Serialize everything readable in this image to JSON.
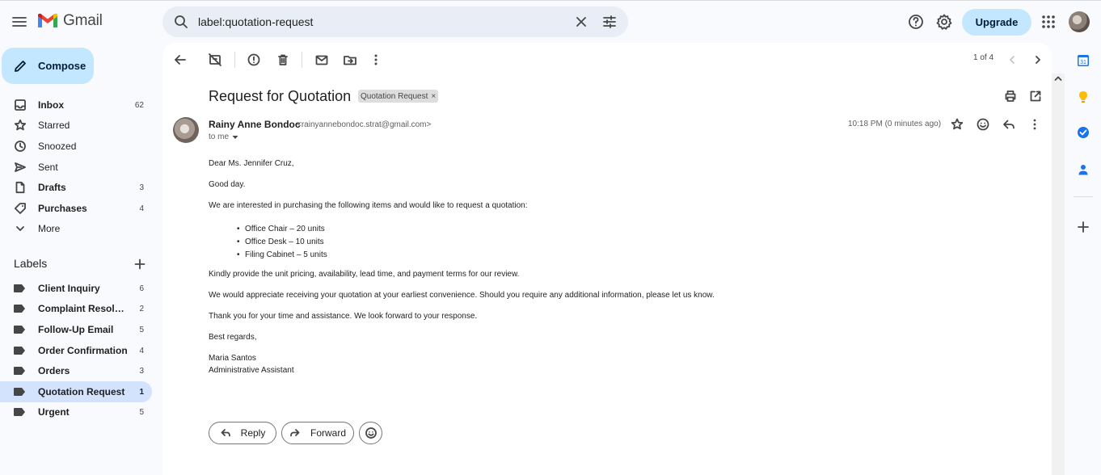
{
  "app": {
    "name": "Gmail"
  },
  "search": {
    "value": "label:quotation-request"
  },
  "header": {
    "upgrade_label": "Upgrade"
  },
  "compose": {
    "label": "Compose"
  },
  "nav": {
    "items": [
      {
        "label": "Inbox",
        "count": "62"
      },
      {
        "label": "Starred",
        "count": ""
      },
      {
        "label": "Snoozed",
        "count": ""
      },
      {
        "label": "Sent",
        "count": ""
      },
      {
        "label": "Drafts",
        "count": "3"
      },
      {
        "label": "Purchases",
        "count": "4"
      },
      {
        "label": "More",
        "count": ""
      }
    ]
  },
  "labels": {
    "heading": "Labels",
    "items": [
      {
        "label": "Client Inquiry",
        "count": "6"
      },
      {
        "label": "Complaint Resolution",
        "count": "2"
      },
      {
        "label": "Follow-Up Email",
        "count": "5"
      },
      {
        "label": "Order Confirmation",
        "count": "4"
      },
      {
        "label": "Orders",
        "count": "3"
      },
      {
        "label": "Quotation Request",
        "count": "1"
      },
      {
        "label": "Urgent",
        "count": "5"
      }
    ]
  },
  "toolbar": {
    "pager": "1 of 4"
  },
  "message": {
    "subject": "Request for Quotation",
    "label_chip": "Quotation Request",
    "sender_name": "Rainy Anne Bondoc",
    "sender_email": "<rainyannebondoc.strat@gmail.com>",
    "recipient": "to me",
    "time": "10:18 PM (0 minutes ago)",
    "body": {
      "greeting": "Dear Ms. Jennifer Cruz,",
      "line1": "Good day.",
      "intro": "We are interested in purchasing the following items and would like to request a quotation:",
      "items": [
        "Office Chair – 20 units",
        "Office Desk – 10 units",
        "Filing Cabinet – 5 units"
      ],
      "request": "Kindly provide the unit pricing, availability, lead time, and payment terms for our review.",
      "appreciate": "We would appreciate receiving your quotation at your earliest convenience. Should you require any additional information, please let us know.",
      "thanks": "Thank you for your time and assistance. We look forward to your response.",
      "closing": "Best regards,",
      "signature_name": "Maria Santos",
      "signature_title": "Administrative Assistant"
    }
  },
  "actions": {
    "reply_label": "Reply",
    "forward_label": "Forward"
  },
  "side_panel": {
    "calendar_day": "31"
  },
  "colors": {
    "accent": "#c2e7ff",
    "active_nav": "#d3e3fd",
    "background": "#f8fafd"
  }
}
